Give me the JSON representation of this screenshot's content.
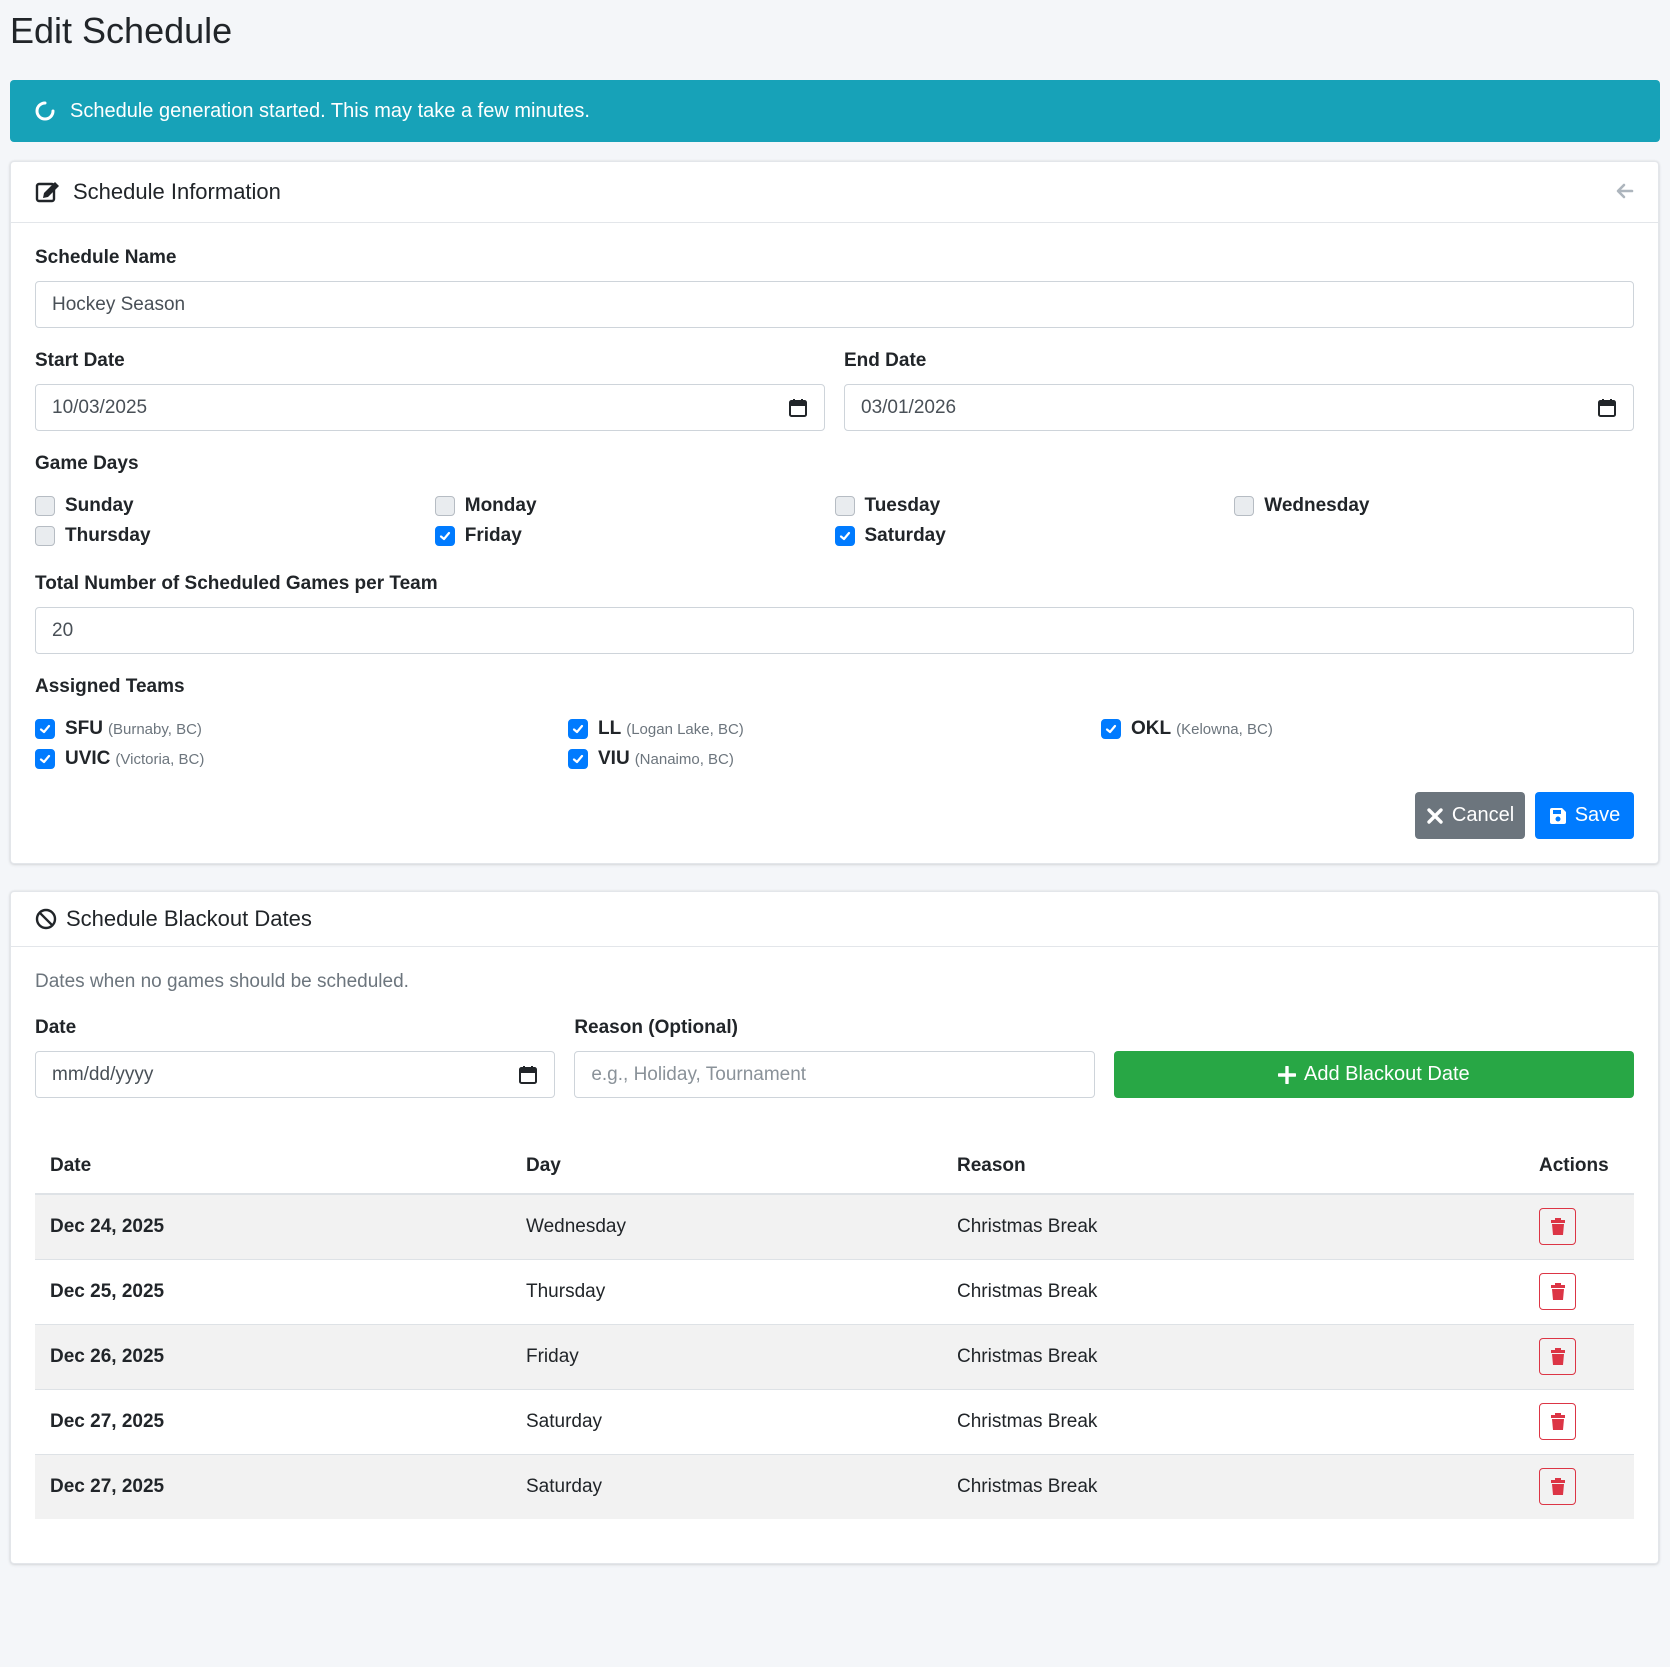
{
  "page": {
    "title": "Edit Schedule"
  },
  "alert": {
    "text": "Schedule generation started. This may take a few minutes."
  },
  "info_card": {
    "title": "Schedule Information",
    "name_label": "Schedule Name",
    "name_value": "Hockey Season",
    "start_label": "Start Date",
    "start_value": "10/03/2025",
    "end_label": "End Date",
    "end_value": "03/01/2026",
    "game_days_label": "Game Days",
    "days": [
      {
        "label": "Sunday",
        "checked": false
      },
      {
        "label": "Monday",
        "checked": false
      },
      {
        "label": "Tuesday",
        "checked": false
      },
      {
        "label": "Wednesday",
        "checked": false
      },
      {
        "label": "Thursday",
        "checked": false
      },
      {
        "label": "Friday",
        "checked": true
      },
      {
        "label": "Saturday",
        "checked": true
      }
    ],
    "games_label": "Total Number of Scheduled Games per Team",
    "games_value": "20",
    "teams_label": "Assigned Teams",
    "teams": [
      {
        "code": "SFU",
        "location": "(Burnaby, BC)",
        "checked": true
      },
      {
        "code": "LL",
        "location": "(Logan Lake, BC)",
        "checked": true
      },
      {
        "code": "OKL",
        "location": "(Kelowna, BC)",
        "checked": true
      },
      {
        "code": "UVIC",
        "location": "(Victoria, BC)",
        "checked": true
      },
      {
        "code": "VIU",
        "location": "(Nanaimo, BC)",
        "checked": true
      }
    ],
    "cancel_label": "Cancel",
    "save_label": "Save"
  },
  "blackout_card": {
    "title": "Schedule Blackout Dates",
    "description": "Dates when no games should be scheduled.",
    "date_label": "Date",
    "date_placeholder": "mm/dd/yyyy",
    "reason_label": "Reason (Optional)",
    "reason_placeholder": "e.g., Holiday, Tournament",
    "add_label": "Add Blackout Date",
    "table": {
      "headers": [
        "Date",
        "Day",
        "Reason",
        "Actions"
      ],
      "rows": [
        {
          "date": "Dec 24, 2025",
          "day": "Wednesday",
          "reason": "Christmas Break"
        },
        {
          "date": "Dec 25, 2025",
          "day": "Thursday",
          "reason": "Christmas Break"
        },
        {
          "date": "Dec 26, 2025",
          "day": "Friday",
          "reason": "Christmas Break"
        },
        {
          "date": "Dec 27, 2025",
          "day": "Saturday",
          "reason": "Christmas Break"
        },
        {
          "date": "Dec 27, 2025",
          "day": "Saturday",
          "reason": "Christmas Break"
        }
      ]
    }
  },
  "colors": {
    "alert": "#17a2b8",
    "primary": "#007bff",
    "secondary": "#6c757d",
    "success": "#28a745",
    "danger": "#dc3545"
  },
  "icons": {
    "alert": "spinner-icon",
    "info_header": "edit-icon",
    "collapse": "arrow-left-icon",
    "calendar": "calendar-icon",
    "cancel": "times-icon",
    "save": "save-icon",
    "blackout_header": "ban-icon",
    "add": "plus-icon",
    "delete": "trash-icon"
  }
}
